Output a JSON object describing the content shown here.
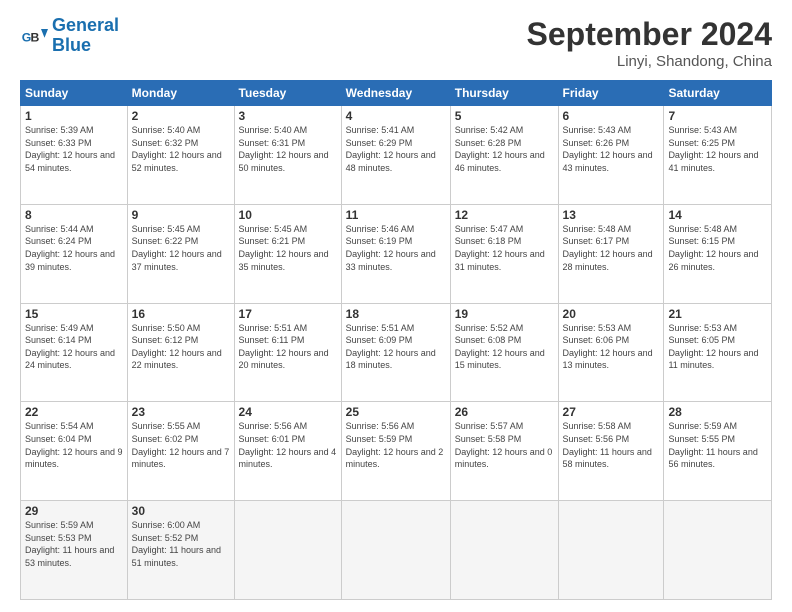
{
  "header": {
    "logo_line1": "General",
    "logo_line2": "Blue",
    "title": "September 2024",
    "location": "Linyi, Shandong, China"
  },
  "weekdays": [
    "Sunday",
    "Monday",
    "Tuesday",
    "Wednesday",
    "Thursday",
    "Friday",
    "Saturday"
  ],
  "weeks": [
    [
      {
        "day": "1",
        "info": "Sunrise: 5:39 AM\nSunset: 6:33 PM\nDaylight: 12 hours\nand 54 minutes."
      },
      {
        "day": "2",
        "info": "Sunrise: 5:40 AM\nSunset: 6:32 PM\nDaylight: 12 hours\nand 52 minutes."
      },
      {
        "day": "3",
        "info": "Sunrise: 5:40 AM\nSunset: 6:31 PM\nDaylight: 12 hours\nand 50 minutes."
      },
      {
        "day": "4",
        "info": "Sunrise: 5:41 AM\nSunset: 6:29 PM\nDaylight: 12 hours\nand 48 minutes."
      },
      {
        "day": "5",
        "info": "Sunrise: 5:42 AM\nSunset: 6:28 PM\nDaylight: 12 hours\nand 46 minutes."
      },
      {
        "day": "6",
        "info": "Sunrise: 5:43 AM\nSunset: 6:26 PM\nDaylight: 12 hours\nand 43 minutes."
      },
      {
        "day": "7",
        "info": "Sunrise: 5:43 AM\nSunset: 6:25 PM\nDaylight: 12 hours\nand 41 minutes."
      }
    ],
    [
      {
        "day": "8",
        "info": "Sunrise: 5:44 AM\nSunset: 6:24 PM\nDaylight: 12 hours\nand 39 minutes."
      },
      {
        "day": "9",
        "info": "Sunrise: 5:45 AM\nSunset: 6:22 PM\nDaylight: 12 hours\nand 37 minutes."
      },
      {
        "day": "10",
        "info": "Sunrise: 5:45 AM\nSunset: 6:21 PM\nDaylight: 12 hours\nand 35 minutes."
      },
      {
        "day": "11",
        "info": "Sunrise: 5:46 AM\nSunset: 6:19 PM\nDaylight: 12 hours\nand 33 minutes."
      },
      {
        "day": "12",
        "info": "Sunrise: 5:47 AM\nSunset: 6:18 PM\nDaylight: 12 hours\nand 31 minutes."
      },
      {
        "day": "13",
        "info": "Sunrise: 5:48 AM\nSunset: 6:17 PM\nDaylight: 12 hours\nand 28 minutes."
      },
      {
        "day": "14",
        "info": "Sunrise: 5:48 AM\nSunset: 6:15 PM\nDaylight: 12 hours\nand 26 minutes."
      }
    ],
    [
      {
        "day": "15",
        "info": "Sunrise: 5:49 AM\nSunset: 6:14 PM\nDaylight: 12 hours\nand 24 minutes."
      },
      {
        "day": "16",
        "info": "Sunrise: 5:50 AM\nSunset: 6:12 PM\nDaylight: 12 hours\nand 22 minutes."
      },
      {
        "day": "17",
        "info": "Sunrise: 5:51 AM\nSunset: 6:11 PM\nDaylight: 12 hours\nand 20 minutes."
      },
      {
        "day": "18",
        "info": "Sunrise: 5:51 AM\nSunset: 6:09 PM\nDaylight: 12 hours\nand 18 minutes."
      },
      {
        "day": "19",
        "info": "Sunrise: 5:52 AM\nSunset: 6:08 PM\nDaylight: 12 hours\nand 15 minutes."
      },
      {
        "day": "20",
        "info": "Sunrise: 5:53 AM\nSunset: 6:06 PM\nDaylight: 12 hours\nand 13 minutes."
      },
      {
        "day": "21",
        "info": "Sunrise: 5:53 AM\nSunset: 6:05 PM\nDaylight: 12 hours\nand 11 minutes."
      }
    ],
    [
      {
        "day": "22",
        "info": "Sunrise: 5:54 AM\nSunset: 6:04 PM\nDaylight: 12 hours\nand 9 minutes."
      },
      {
        "day": "23",
        "info": "Sunrise: 5:55 AM\nSunset: 6:02 PM\nDaylight: 12 hours\nand 7 minutes."
      },
      {
        "day": "24",
        "info": "Sunrise: 5:56 AM\nSunset: 6:01 PM\nDaylight: 12 hours\nand 4 minutes."
      },
      {
        "day": "25",
        "info": "Sunrise: 5:56 AM\nSunset: 5:59 PM\nDaylight: 12 hours\nand 2 minutes."
      },
      {
        "day": "26",
        "info": "Sunrise: 5:57 AM\nSunset: 5:58 PM\nDaylight: 12 hours\nand 0 minutes."
      },
      {
        "day": "27",
        "info": "Sunrise: 5:58 AM\nSunset: 5:56 PM\nDaylight: 11 hours\nand 58 minutes."
      },
      {
        "day": "28",
        "info": "Sunrise: 5:59 AM\nSunset: 5:55 PM\nDaylight: 11 hours\nand 56 minutes."
      }
    ],
    [
      {
        "day": "29",
        "info": "Sunrise: 5:59 AM\nSunset: 5:53 PM\nDaylight: 11 hours\nand 53 minutes."
      },
      {
        "day": "30",
        "info": "Sunrise: 6:00 AM\nSunset: 5:52 PM\nDaylight: 11 hours\nand 51 minutes."
      },
      {
        "day": "",
        "info": ""
      },
      {
        "day": "",
        "info": ""
      },
      {
        "day": "",
        "info": ""
      },
      {
        "day": "",
        "info": ""
      },
      {
        "day": "",
        "info": ""
      }
    ]
  ]
}
